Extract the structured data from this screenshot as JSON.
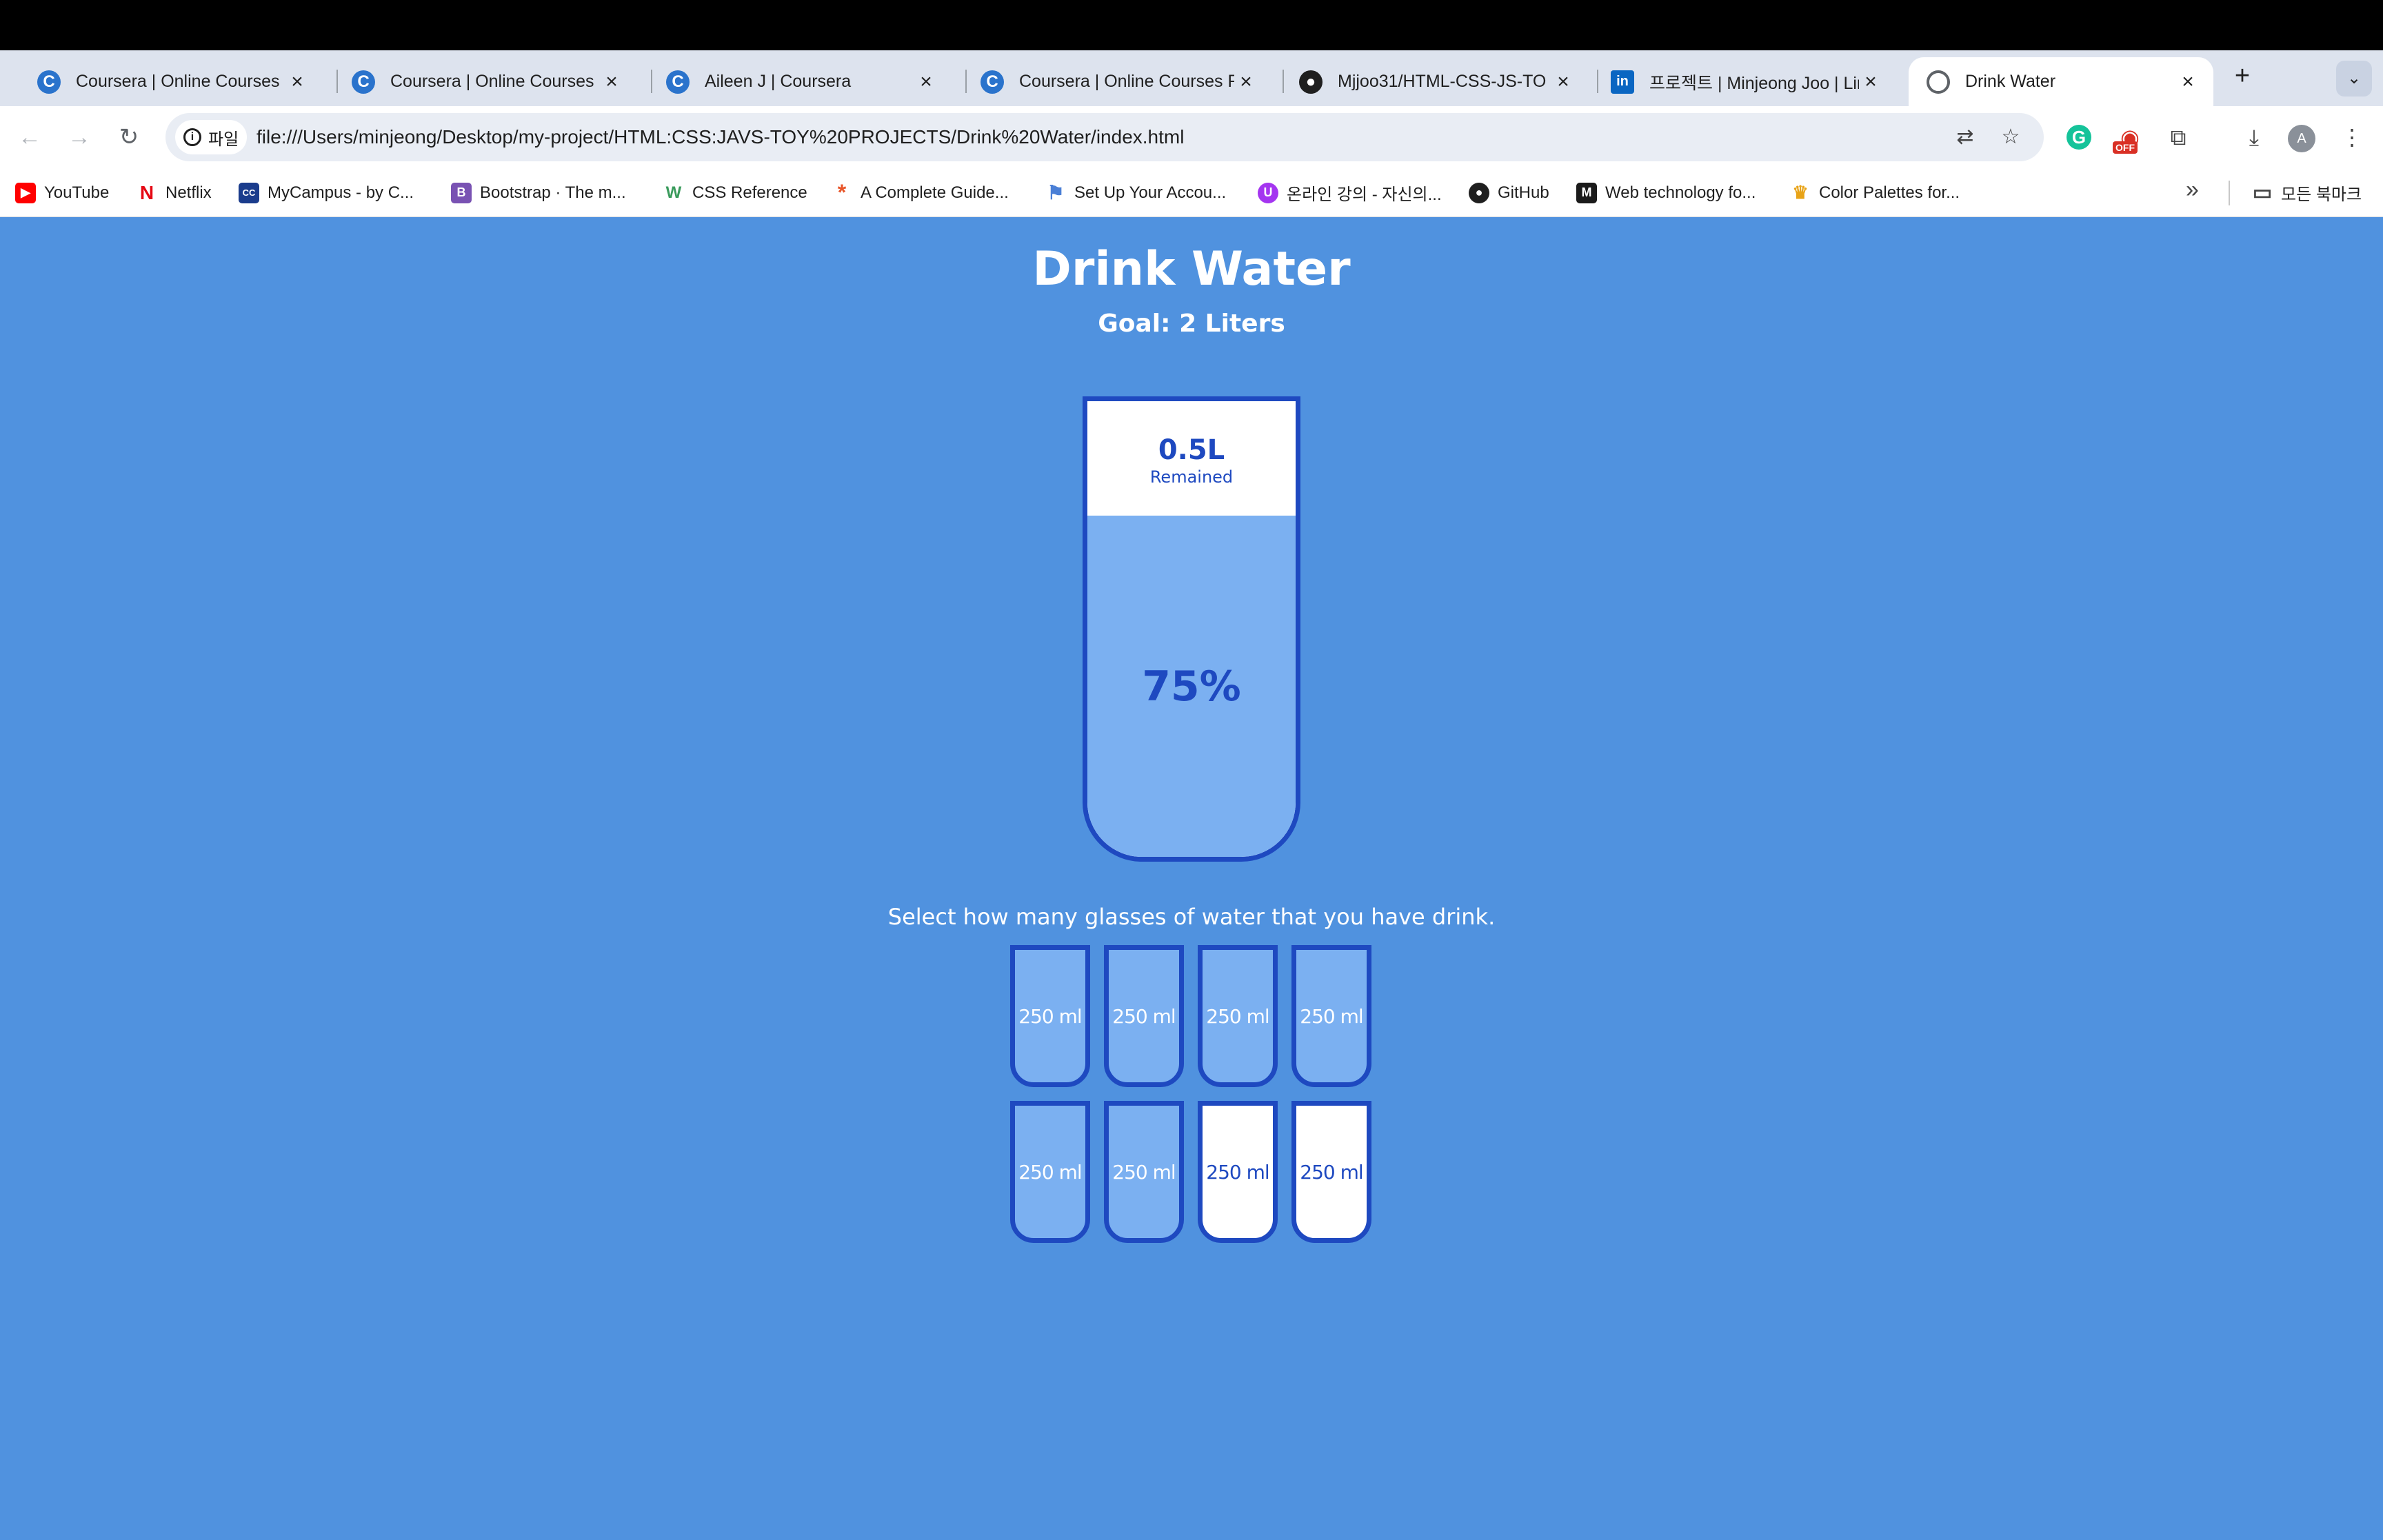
{
  "browser": {
    "tabs": [
      {
        "title": "Coursera | Online Courses F",
        "icon": "coursera-icon",
        "glyph": "C",
        "active": false
      },
      {
        "title": "Coursera | Online Courses F",
        "icon": "coursera-icon",
        "glyph": "C",
        "active": false
      },
      {
        "title": "Aileen J | Coursera",
        "icon": "coursera-icon",
        "glyph": "C",
        "active": false
      },
      {
        "title": "Coursera | Online Courses F",
        "icon": "coursera-icon",
        "glyph": "C",
        "active": false
      },
      {
        "title": "Mjjoo31/HTML-CSS-JS-TO",
        "icon": "github-icon",
        "glyph": "●",
        "active": false
      },
      {
        "title": "프로젝트 | Minjeong Joo | Lin",
        "icon": "linkedin-icon",
        "glyph": "in",
        "active": false
      },
      {
        "title": "Drink Water",
        "icon": "globe-icon",
        "glyph": "",
        "active": true
      }
    ],
    "site_chip": "파일",
    "url": "file:///Users/minjeong/Desktop/my-project/HTML:CSS:JAVS-TOY%20PROJECTS/Drink%20Water/index.html",
    "extension_badge": "OFF",
    "avatar_initial": "A",
    "bookmarks": [
      {
        "label": "YouTube",
        "icon": "youtube-icon",
        "glyph": "▶",
        "color": "#ff0000"
      },
      {
        "label": "Netflix",
        "icon": "netflix-icon",
        "glyph": "N",
        "color": "#e50914"
      },
      {
        "label": "MyCampus - by C...",
        "icon": "mycampus-icon",
        "glyph": "CC",
        "color": "#1a3c8c"
      },
      {
        "label": "Bootstrap · The m...",
        "icon": "bootstrap-icon",
        "glyph": "B",
        "color": "#7952b3"
      },
      {
        "label": "CSS Reference",
        "icon": "css-reference-icon",
        "glyph": "W",
        "color": "#3a9b5c"
      },
      {
        "label": "A Complete Guide...",
        "icon": "css-tricks-icon",
        "glyph": "*",
        "color": "#e8562a"
      },
      {
        "label": "Set Up Your Accou...",
        "icon": "flag-icon",
        "glyph": "⚑",
        "color": "#4a7fd6"
      },
      {
        "label": "온라인 강의 - 자신의...",
        "icon": "udemy-icon",
        "glyph": "U",
        "color": "#a435f0"
      },
      {
        "label": "GitHub",
        "icon": "github-icon",
        "glyph": "●",
        "color": "#1f1f1f"
      },
      {
        "label": "Web technology fo...",
        "icon": "mdn-icon",
        "glyph": "M",
        "color": "#1b1b1b"
      },
      {
        "label": "Color Palettes for...",
        "icon": "palette-icon",
        "glyph": "♛",
        "color": "#e8a317"
      }
    ],
    "all_bookmarks_label": "모든 북마크"
  },
  "app": {
    "title": "Drink Water",
    "goal_text": "Goal: 2 Liters",
    "remained_amount": "0.5L",
    "remained_label": "Remained",
    "percentage_text": "75%",
    "fill_fraction": 0.75,
    "instruction": "Select how many glasses of water that you have drink.",
    "glasses": [
      {
        "label": "250 ml",
        "full": true
      },
      {
        "label": "250 ml",
        "full": true
      },
      {
        "label": "250 ml",
        "full": true
      },
      {
        "label": "250 ml",
        "full": true
      },
      {
        "label": "250 ml",
        "full": true
      },
      {
        "label": "250 ml",
        "full": true
      },
      {
        "label": "250 ml",
        "full": false
      },
      {
        "label": "250 ml",
        "full": false
      }
    ],
    "colors": {
      "background": "#5092df",
      "accent": "#1e49c0",
      "water": "#7bb0f1",
      "empty": "#ffffff"
    }
  }
}
